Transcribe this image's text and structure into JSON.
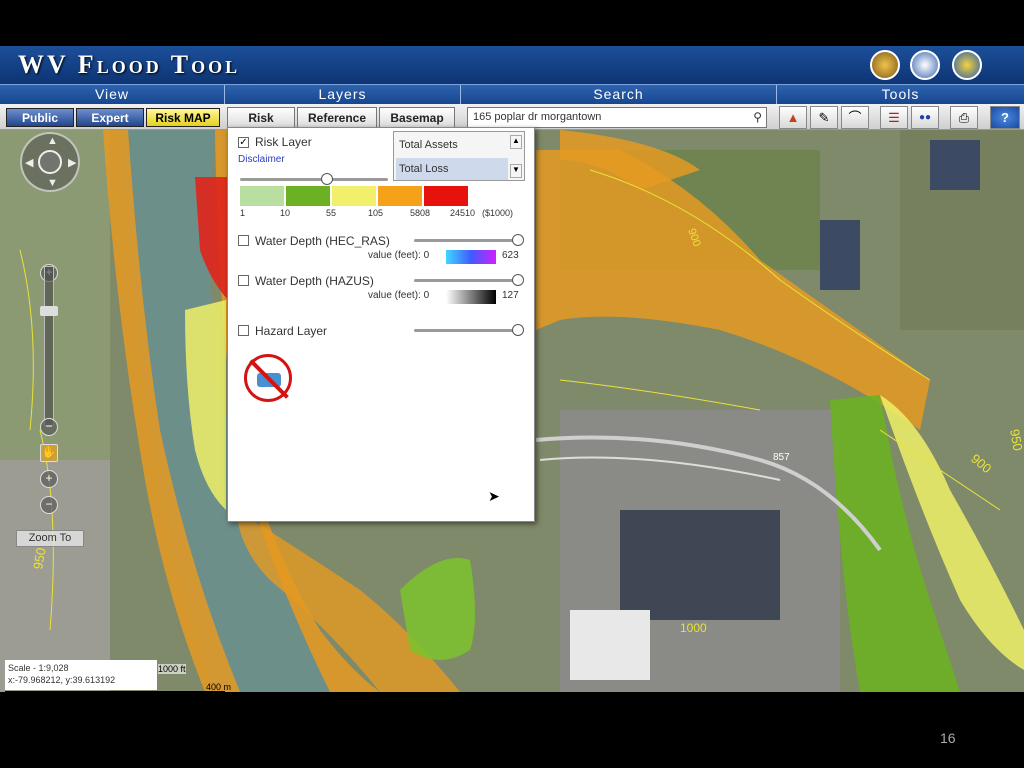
{
  "app": {
    "title": "WV Flood Tool",
    "menus": [
      "View",
      "Layers",
      "Search",
      "Tools"
    ],
    "modes": [
      {
        "label": "Public",
        "active": false
      },
      {
        "label": "Expert",
        "active": false
      },
      {
        "label": "Risk MAP",
        "active": true
      }
    ],
    "tabs": [
      "Risk",
      "Reference",
      "Basemap"
    ],
    "search_value": "165 poplar dr morgantown",
    "tool_icons": [
      "flood-zone-icon",
      "profile-tool-icon",
      "measure-icon",
      "layers-icon",
      "info-icon",
      "print-icon",
      "help-icon"
    ]
  },
  "panel": {
    "risk_layer": {
      "label": "Risk Layer",
      "checked": true,
      "opacity": 0.65
    },
    "disclaimer": "Disclaimer",
    "asset_options": [
      "Total Assets",
      "Total Loss"
    ],
    "selected_asset": "Total Loss",
    "legend": {
      "colors": [
        "#b9dfa0",
        "#6cb023",
        "#f2f06a",
        "#f5a11a",
        "#e8120c"
      ],
      "labels": [
        "1",
        "10",
        "55",
        "105",
        "5808",
        "24510"
      ],
      "unit": "($1000)"
    },
    "water_depth_hec": {
      "label": "Water Depth (HEC_RAS)",
      "checked": false,
      "value_label": "value (feet): 0",
      "max": "623",
      "opacity": 1.0
    },
    "water_depth_hazus": {
      "label": "Water Depth (HAZUS)",
      "checked": false,
      "value_label": "value (feet): 0",
      "max": "127",
      "opacity": 1.0
    },
    "hazard_layer": {
      "label": "Hazard Layer",
      "checked": false,
      "opacity": 1.0
    }
  },
  "map": {
    "zoom_to": "Zoom To",
    "scale": "Scale - 1:9,028",
    "coords": "x:-79.968212, y:39.613192",
    "scale_bar_m": "400 m",
    "scale_bar_ft": "1000 ft",
    "contour_labels": [
      "950",
      "900",
      "900",
      "950"
    ],
    "road_labels": [
      "857",
      "1000"
    ]
  },
  "slide_number": "16"
}
